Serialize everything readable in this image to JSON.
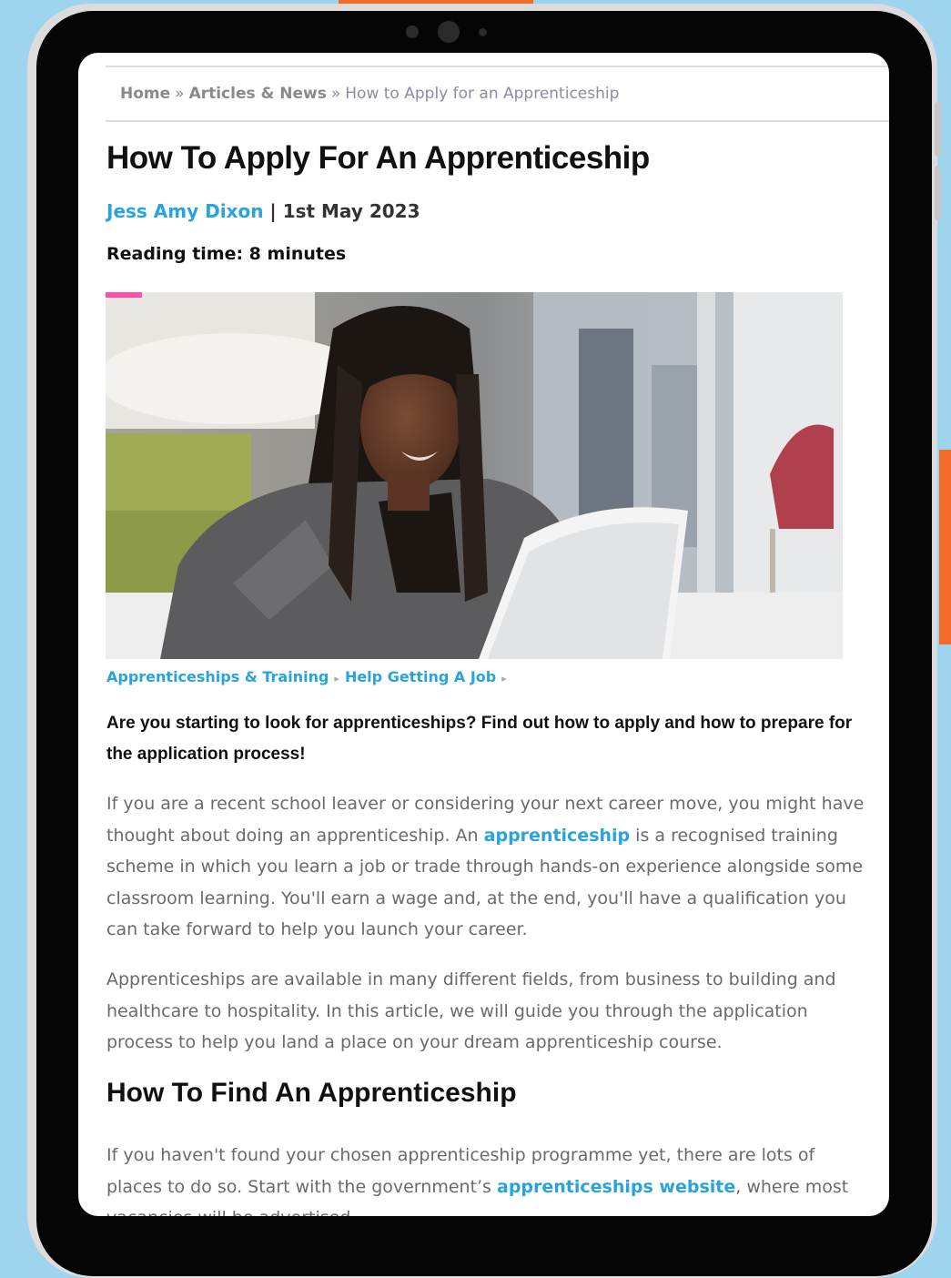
{
  "colors": {
    "accent": "#29a3dc",
    "background": "#9fd4ee",
    "decor": "#f26b2a"
  },
  "breadcrumb": {
    "home": "Home",
    "section": "Articles & News",
    "current": "How to Apply for an Apprenticeship",
    "separator": "»"
  },
  "article": {
    "title": "How To Apply For An Apprenticeship",
    "author": "Jess Amy Dixon",
    "meta_separator": "|",
    "date": "1st May 2023",
    "reading_time": "Reading time: 8 minutes",
    "hero_image": "woman-working-on-laptop-photo",
    "tags": [
      "Apprenticeships & Training",
      "Help Getting A Job"
    ],
    "lede": "Are you starting to look for apprenticeships? Find out how to apply and how to prepare for the application process!",
    "p1_before": "If you are a recent school leaver or considering your next career move, you might have thought about doing an apprenticeship. An ",
    "p1_link": "apprenticeship",
    "p1_after": " is a recognised training scheme in which you learn a job or trade through hands-on experience alongside some classroom learning. You'll earn a wage and, at the end, you'll have a qualification you can take forward to help you launch your career.",
    "p2": "Apprenticeships are available in many different fields, from business to building and healthcare to hospitality. In this article, we will guide you through the application process to help you land a place on your dream apprenticeship course.",
    "subheading": "How To Find An Apprenticeship",
    "p3_before": "If you haven't found your chosen apprenticeship programme yet, there are lots of places to do so. Start with the government’s ",
    "p3_link": "apprenticeships website",
    "p3_after": ", where most vacancies will be advertised."
  }
}
